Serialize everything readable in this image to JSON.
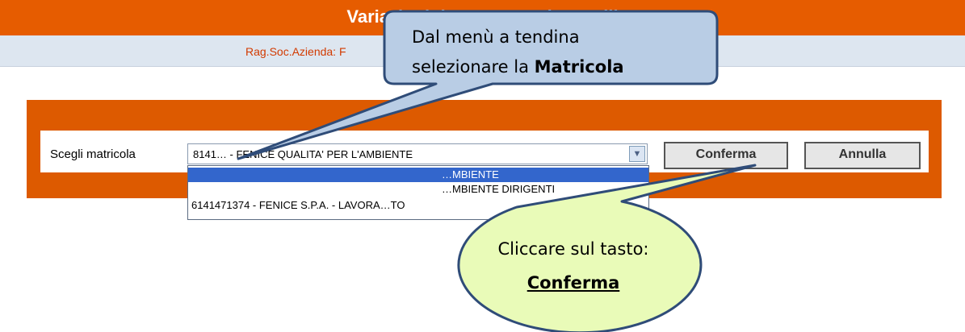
{
  "header": {
    "title": "Variazioni denunce re…i mensili"
  },
  "subheader": {
    "company_label": "Rag.Soc.Azienda: F"
  },
  "form": {
    "field_label": "Scegli matricola",
    "select": {
      "value": "8141… - FENICE QUALITA' PER L'AMBIENTE",
      "options": [
        "…MBIENTE",
        "…MBIENTE DIRIGENTI",
        "6141471374 - FENICE S.P.A. - LAVORA…TO"
      ]
    },
    "confirm_label": "Conferma",
    "cancel_label": "Annulla"
  },
  "callouts": {
    "top": {
      "line1": "Dal menù a tendina",
      "line2_prefix": "selezionare la ",
      "line2_bold": "Matricola"
    },
    "bottom": {
      "line1": "Cliccare sul tasto:",
      "line2": "Conferma"
    },
    "colors": {
      "top_fill": "#b9cde5",
      "top_stroke": "#2f4c78",
      "bottom_fill": "#e9fbb8",
      "bottom_stroke": "#2f4c78"
    }
  }
}
